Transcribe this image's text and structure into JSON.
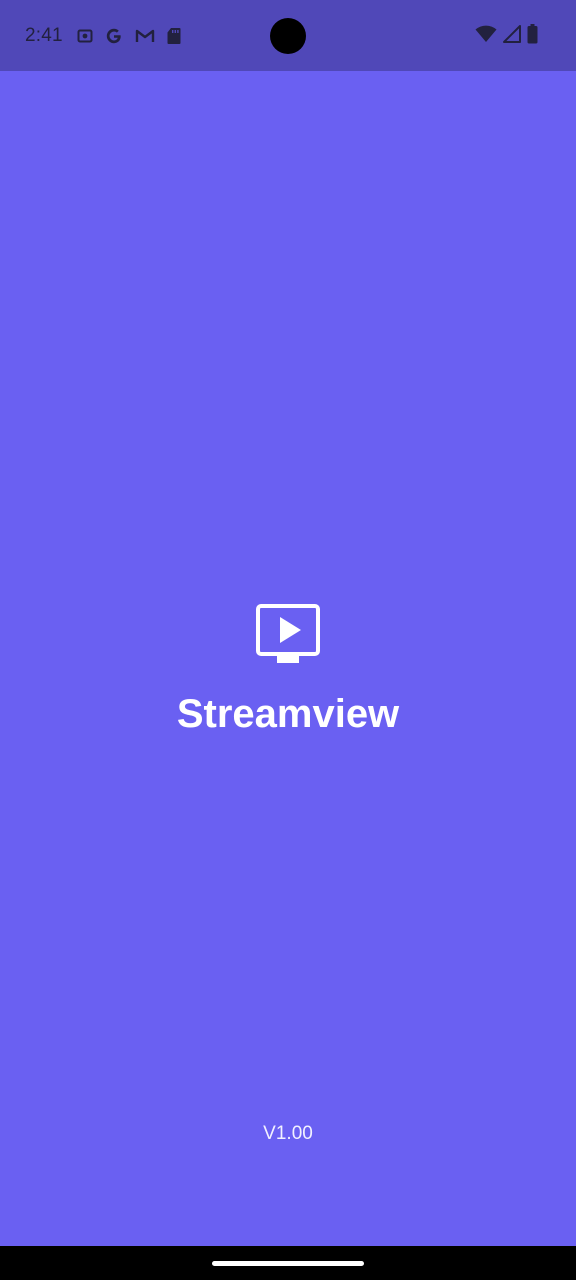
{
  "status_bar": {
    "time": "2:41",
    "left_icons": [
      "screen-record-icon",
      "google-icon",
      "gmail-icon",
      "sd-card-icon"
    ],
    "right_icons": [
      "wifi-icon",
      "cellular-signal-icon",
      "battery-icon"
    ]
  },
  "app": {
    "logo_icon": "tv-play-icon",
    "name": "Streamview",
    "version": "V1.00"
  },
  "colors": {
    "background": "#6A60F2",
    "status_bar": "#5048B8",
    "text": "#FFFFFF"
  }
}
